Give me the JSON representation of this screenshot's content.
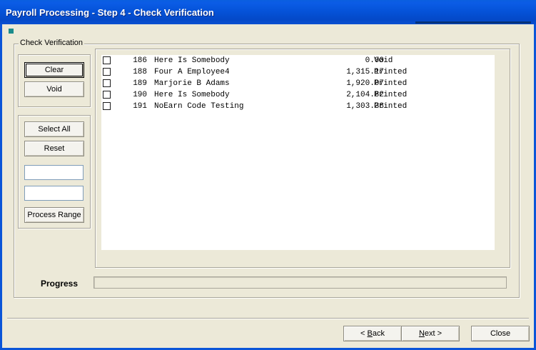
{
  "window": {
    "title": "Payroll Processing - Step 4 - Check Verification"
  },
  "group": {
    "label": "Check Verification"
  },
  "left_panel": {
    "clear_label": "Clear",
    "void_label": "Void",
    "select_all_label": "Select All",
    "reset_label": "Reset",
    "range_from": "",
    "range_to": "",
    "process_range_label": "Process Range"
  },
  "checks": [
    {
      "number": "186",
      "name": "Here Is Somebody",
      "amount": "0.00",
      "status": "Void",
      "checked": false
    },
    {
      "number": "188",
      "name": "Four A Employee4",
      "amount": "1,315.17",
      "status": "Printed",
      "checked": false
    },
    {
      "number": "189",
      "name": "Marjorie B Adams",
      "amount": "1,920.07",
      "status": "Printed",
      "checked": false
    },
    {
      "number": "190",
      "name": "Here Is Somebody",
      "amount": "2,104.82",
      "status": "Printed",
      "checked": false
    },
    {
      "number": "191",
      "name": "NoEarn Code Testing",
      "amount": "1,303.38",
      "status": "Printed",
      "checked": false
    }
  ],
  "progress": {
    "label": "Progress",
    "value": 0
  },
  "footer": {
    "back_prefix": "< ",
    "back_key": "B",
    "back_rest": "ack",
    "next_key": "N",
    "next_rest": "ext >",
    "close_label": "Close"
  },
  "colors": {
    "titlebar": "#0553D9",
    "window_bg": "#ECE9D8",
    "status_dot": "#1A8C8C"
  }
}
